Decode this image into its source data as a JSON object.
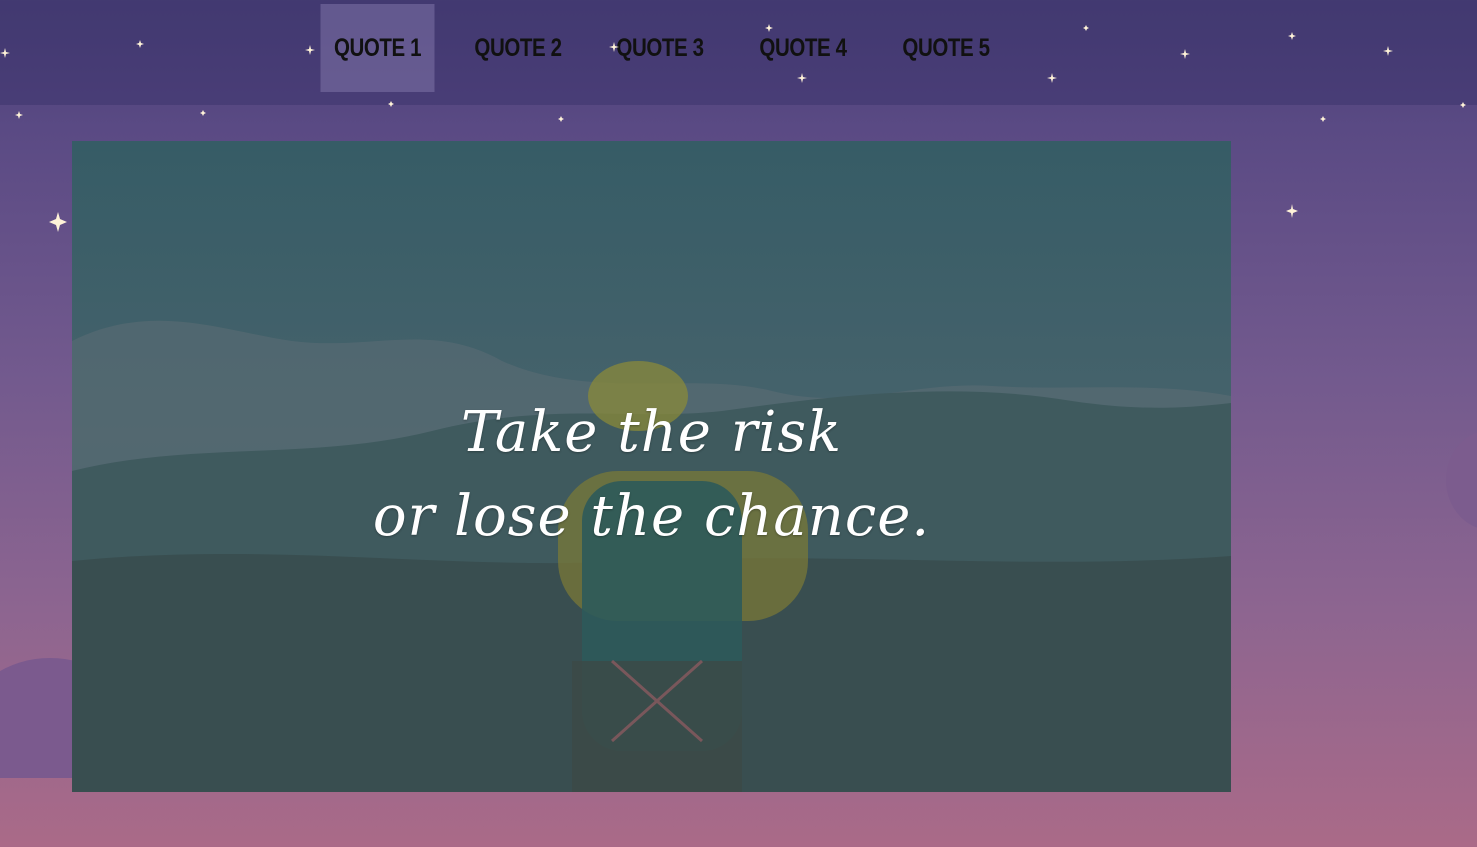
{
  "nav": {
    "items": [
      {
        "label": "QUOTE 1",
        "active": true
      },
      {
        "label": "QUOTE 2",
        "active": false
      },
      {
        "label": "QUOTE 3",
        "active": false
      },
      {
        "label": "QUOTE 4",
        "active": false
      },
      {
        "label": "QUOTE 5",
        "active": false
      }
    ]
  },
  "hero": {
    "quote_line1": "Take the risk",
    "quote_line2": "or lose the chance."
  },
  "colors": {
    "background_top": "#473e75",
    "background_bottom": "#aa6a88",
    "nav_text": "#111111",
    "quote_text": "#ffffff",
    "photo_tint": "#3f5d66"
  }
}
